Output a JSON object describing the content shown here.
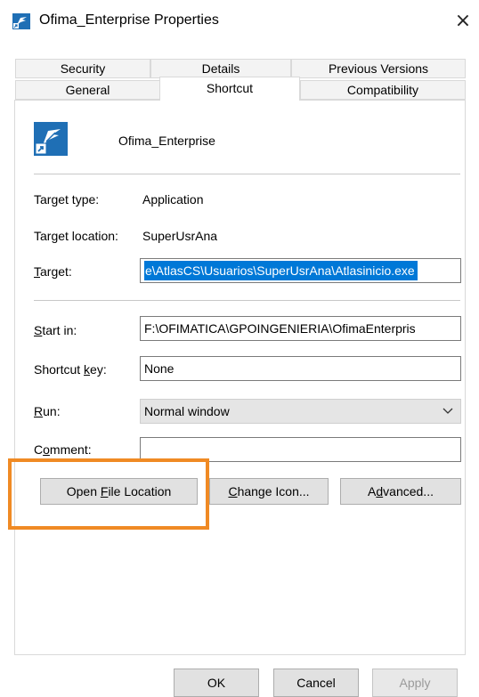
{
  "window": {
    "title": "Ofima_Enterprise Properties",
    "close_glyph": "×"
  },
  "tabs": {
    "row1": [
      "Security",
      "Details",
      "Previous Versions"
    ],
    "row2": [
      "General",
      "Shortcut",
      "Compatibility"
    ],
    "active": "Shortcut"
  },
  "header": {
    "app_name": "Ofima_Enterprise"
  },
  "properties": {
    "target_type_label": "Target type:",
    "target_type_value": "Application",
    "target_location_label": "Target location:",
    "target_location_value": "SuperUsrAna",
    "target_label": "Target:",
    "target_value": "e\\AtlasCS\\Usuarios\\SuperUsrAna\\Atlasinicio.exe",
    "start_in_label": "Start in:",
    "start_in_value": "F:\\OFIMATICA\\GPOINGENIERIA\\OfimaEnterpris",
    "shortcut_key_label": "Shortcut key:",
    "shortcut_key_value": "None",
    "run_label": "Run:",
    "run_value": "Normal window",
    "comment_label": "Comment:",
    "comment_value": ""
  },
  "buttons": {
    "open_file_location": "Open File Location",
    "change_icon": "Change Icon...",
    "advanced": "Advanced...",
    "ok": "OK",
    "cancel": "Cancel",
    "apply": "Apply"
  },
  "icons": {
    "title_icon": "shortcut-app-icon",
    "app_icon": "ofima-app-icon",
    "chevron": "chevron-down-icon",
    "close": "close-icon"
  },
  "colors": {
    "highlight": "#f08a24",
    "selection": "#0078d7",
    "app_icon_bg": "#1f6fb5"
  }
}
